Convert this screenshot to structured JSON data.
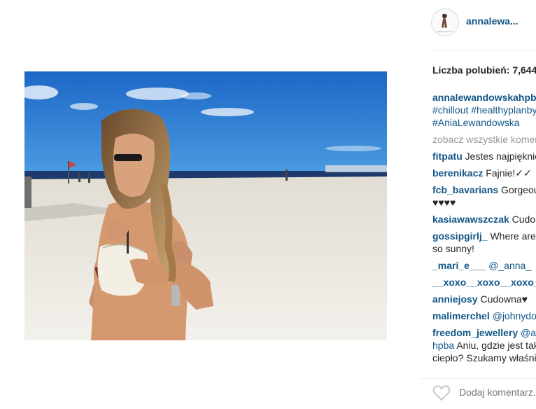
{
  "post": {
    "username": "annalewa...",
    "avatar_text": "healthyplanbyann"
  },
  "likes": "Liczba polubień: 7,644",
  "caption": {
    "user": "annalewandowskahpba",
    "line2": "#chillout #healthyplanbyann",
    "line3": "#AniaLewandowska"
  },
  "view_all": "zobacz wszystkie komentarze",
  "comments": [
    {
      "user": "fitpatu",
      "text": " Jestes najpiękniejsza"
    },
    {
      "user": "berenikacz",
      "text": " Fajnie!✓✓"
    },
    {
      "user": "fcb_bavarians",
      "text": " Gorgeous",
      "text2": "♥♥♥♥"
    },
    {
      "user": "kasiawawszczak",
      "text": " Cudo"
    },
    {
      "user": "gossipgirlj_",
      "text": " Where are you?",
      "text2": "so sunny!"
    },
    {
      "user": "_mari_e___",
      "mention": " @_anna_"
    },
    {
      "user": "__xoxo__xoxo__xoxo__",
      "text": ""
    },
    {
      "user": "anniejosy",
      "text": " Cudowna♥"
    },
    {
      "user": "malimerchel",
      "mention": " @johnydoe"
    },
    {
      "user": "freedom_jewellery",
      "mention": " @annalewandowska",
      "line2_user": "hpba",
      "line2_text": " Aniu, gdzie jest tak",
      "line3": "ciepło? Szukamy właśnie"
    }
  ],
  "footer": {
    "add_comment_placeholder": "Dodaj komentarz..."
  },
  "colors": {
    "link": "#125688",
    "muted": "#999999",
    "sky": "#2f7fd6",
    "sand": "#eeeae3"
  }
}
